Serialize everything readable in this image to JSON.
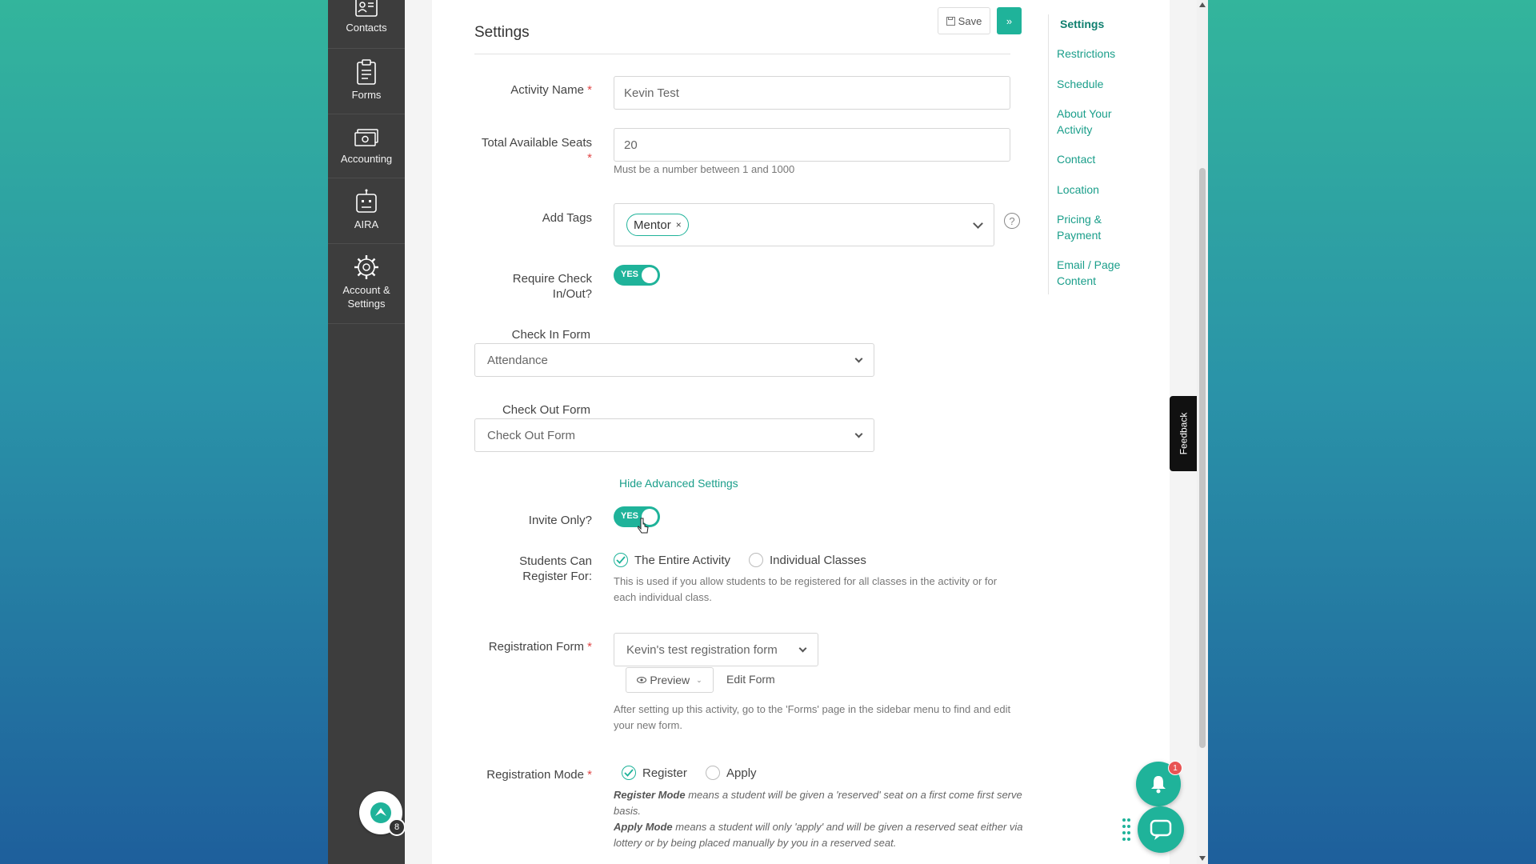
{
  "sidebar": {
    "items": [
      {
        "label": "Contacts",
        "icon": "contact-card-icon"
      },
      {
        "label": "Forms",
        "icon": "clipboard-icon"
      },
      {
        "label": "Accounting",
        "icon": "cash-icon"
      },
      {
        "label": "AIRA",
        "icon": "robot-icon"
      },
      {
        "label": "Account & Settings",
        "icon": "gear-icon"
      }
    ],
    "app_badge": "8"
  },
  "header": {
    "title": "Settings",
    "save_label": "Save",
    "next_label": "»"
  },
  "form": {
    "activity_name": {
      "label": "Activity Name",
      "required": "*",
      "value": "Kevin Test"
    },
    "total_seats": {
      "label": "Total Available Seats",
      "required": "*",
      "value": "20",
      "help": "Must be a number between 1 and 1000"
    },
    "tags": {
      "label": "Add Tags",
      "tag": "Mentor",
      "remove": "×",
      "help_icon": "?"
    },
    "require_check": {
      "label": "Require Check In/Out?",
      "toggle_text": "YES"
    },
    "check_in_form": {
      "label": "Check In Form",
      "value": "Attendance"
    },
    "check_out_form": {
      "label": "Check Out Form",
      "value": "Check Out Form"
    },
    "hide_advanced": "Hide Advanced Settings",
    "invite_only": {
      "label": "Invite Only?",
      "toggle_text": "YES"
    },
    "students_register": {
      "label": "Students Can Register For:",
      "option1": "The Entire Activity",
      "option2": "Individual Classes",
      "help": "This is used if you allow students to be registered for all classes in the activity or for each individual class."
    },
    "registration_form": {
      "label": "Registration Form",
      "required": "*",
      "value": "Kevin's test registration form",
      "preview_label": "Preview",
      "edit_label": "Edit Form",
      "help": "After setting up this activity, go to the 'Forms' page in the sidebar menu to find and edit your new form."
    },
    "registration_mode": {
      "label": "Registration Mode",
      "required": "*",
      "option1": "Register",
      "option2": "Apply",
      "register_title": "Register Mode",
      "register_desc": " means a student will be given a 'reserved' seat on a first come first serve basis.",
      "apply_title": "Apply Mode",
      "apply_desc": " means a student will only 'apply' and will be given a reserved seat either via lottery or by being placed manually by you in a reserved seat."
    }
  },
  "right_nav": {
    "items": [
      "Settings",
      "Restrictions",
      "Schedule",
      "About Your Activity",
      "Contact",
      "Location",
      "Pricing & Payment",
      "Email / Page Content"
    ]
  },
  "feedback_label": "Feedback",
  "notifications_badge": "1",
  "colors": {
    "accent": "#1fb39a",
    "sidebar": "#3d3d3d"
  }
}
